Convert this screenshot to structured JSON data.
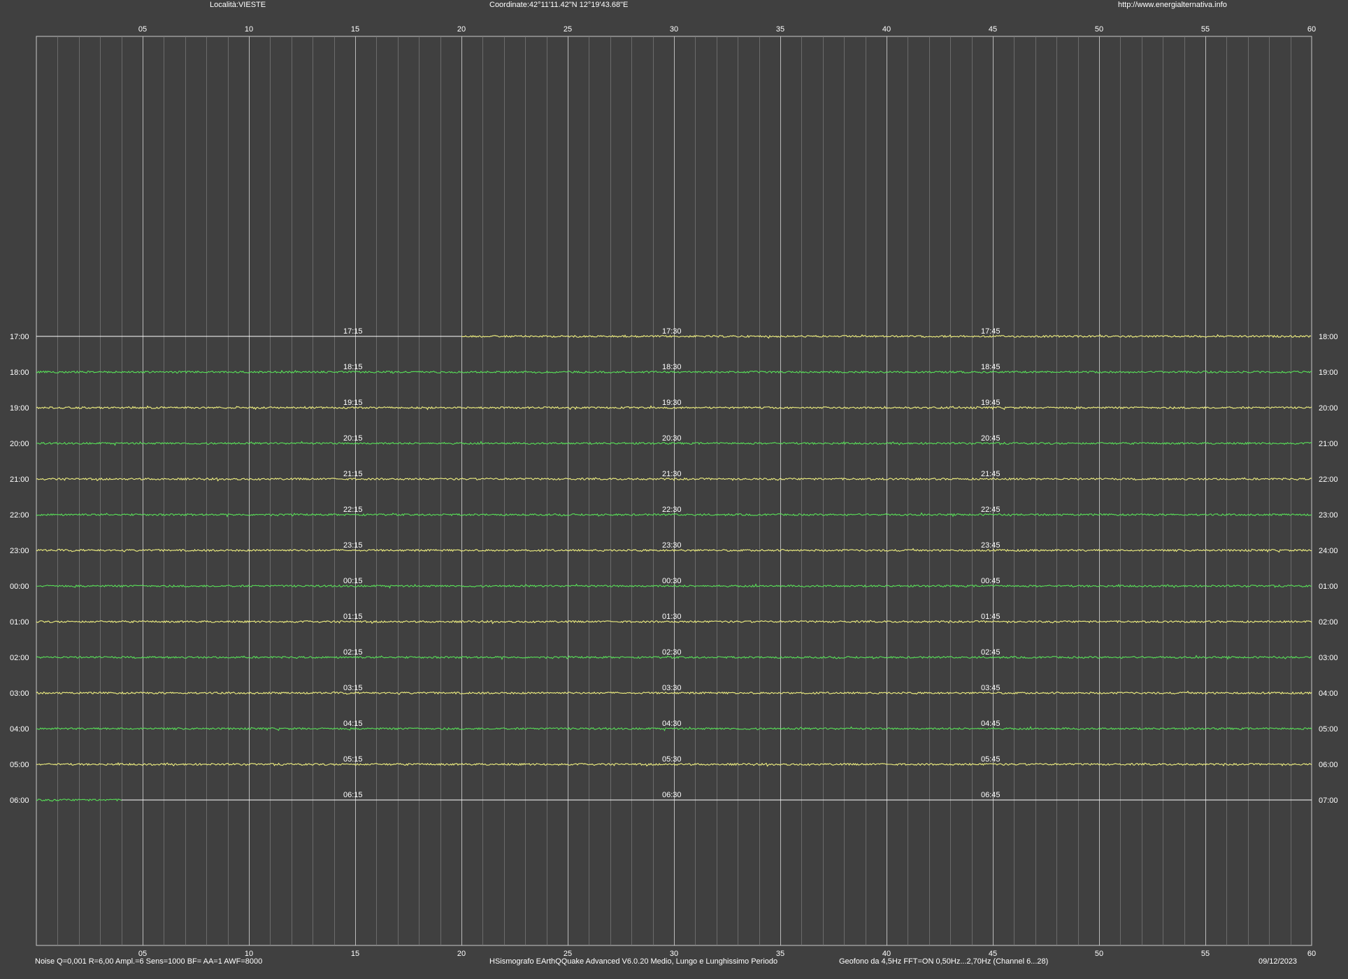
{
  "header": {
    "locality": "Località:VIESTE",
    "coordinates": "Coordinate:42°11'11.42\"N  12°19'43.68\"E",
    "website": "http://www.energialternativa.info"
  },
  "footer": {
    "settings": "Noise Q=0,001 R=6,00 Ampl.=6 Sens=1000 BF= AA=1 AWF=8000",
    "software": "HSismografo  EArthQQuake Advanced V6.0.20  Medio, Lungo e Lunghissimo Periodo",
    "sensor": "Geofono da 4,5Hz FFT=ON 0,50Hz...2,70Hz      (Channel 6...28)",
    "date": "09/12/2023"
  },
  "colors": {
    "background": "#404040",
    "grid_minor": "#7a7a7a",
    "grid_major": "#c8c8c8",
    "trace_yellow": "#f0f080",
    "trace_green": "#58e058"
  },
  "chart_data": {
    "type": "line",
    "xlabel": "",
    "ylabel": "",
    "xlim": [
      0,
      60
    ],
    "x_tick_labels": [
      "05",
      "10",
      "15",
      "20",
      "25",
      "30",
      "35",
      "40",
      "45",
      "50",
      "55",
      "60"
    ],
    "left_labels": [
      "17:00",
      "18:00",
      "19:00",
      "20:00",
      "21:00",
      "22:00",
      "23:00",
      "00:00",
      "01:00",
      "02:00",
      "03:00",
      "04:00",
      "05:00",
      "06:00"
    ],
    "right_labels": [
      "18:00",
      "19:00",
      "20:00",
      "21:00",
      "22:00",
      "23:00",
      "24:00",
      "01:00",
      "02:00",
      "03:00",
      "04:00",
      "05:00",
      "06:00",
      "07:00"
    ],
    "quarter_labels": [
      [
        "17:15",
        "17:30",
        "17:45"
      ],
      [
        "18:15",
        "18:30",
        "18:45"
      ],
      [
        "19:15",
        "19:30",
        "19:45"
      ],
      [
        "20:15",
        "20:30",
        "20:45"
      ],
      [
        "21:15",
        "21:30",
        "21:45"
      ],
      [
        "22:15",
        "22:30",
        "22:45"
      ],
      [
        "23:15",
        "23:30",
        "23:45"
      ],
      [
        "00:15",
        "00:30",
        "00:45"
      ],
      [
        "01:15",
        "01:30",
        "01:45"
      ],
      [
        "02:15",
        "02:30",
        "02:45"
      ],
      [
        "03:15",
        "03:30",
        "03:45"
      ],
      [
        "04:15",
        "04:30",
        "04:45"
      ],
      [
        "05:15",
        "05:30",
        "05:45"
      ],
      [
        "06:15",
        "06:30",
        "06:45"
      ]
    ],
    "quarter_minutes": [
      15,
      30,
      45
    ],
    "series": [
      {
        "hour": "17:00",
        "color": "yellow",
        "start": 20,
        "end": 60
      },
      {
        "hour": "18:00",
        "color": "green",
        "start": 0,
        "end": 60
      },
      {
        "hour": "19:00",
        "color": "yellow",
        "start": 0,
        "end": 60
      },
      {
        "hour": "20:00",
        "color": "green",
        "start": 0,
        "end": 60
      },
      {
        "hour": "21:00",
        "color": "yellow",
        "start": 0,
        "end": 60
      },
      {
        "hour": "22:00",
        "color": "green",
        "start": 0,
        "end": 60
      },
      {
        "hour": "23:00",
        "color": "yellow",
        "start": 0,
        "end": 60
      },
      {
        "hour": "00:00",
        "color": "green",
        "start": 0,
        "end": 60
      },
      {
        "hour": "01:00",
        "color": "yellow",
        "start": 0,
        "end": 60
      },
      {
        "hour": "02:00",
        "color": "green",
        "start": 0,
        "end": 60
      },
      {
        "hour": "03:00",
        "color": "yellow",
        "start": 0,
        "end": 60
      },
      {
        "hour": "04:00",
        "color": "green",
        "start": 0,
        "end": 60
      },
      {
        "hour": "05:00",
        "color": "yellow",
        "start": 0,
        "end": 60
      },
      {
        "hour": "06:00",
        "color": "green",
        "start": 0,
        "end": 4
      }
    ]
  }
}
